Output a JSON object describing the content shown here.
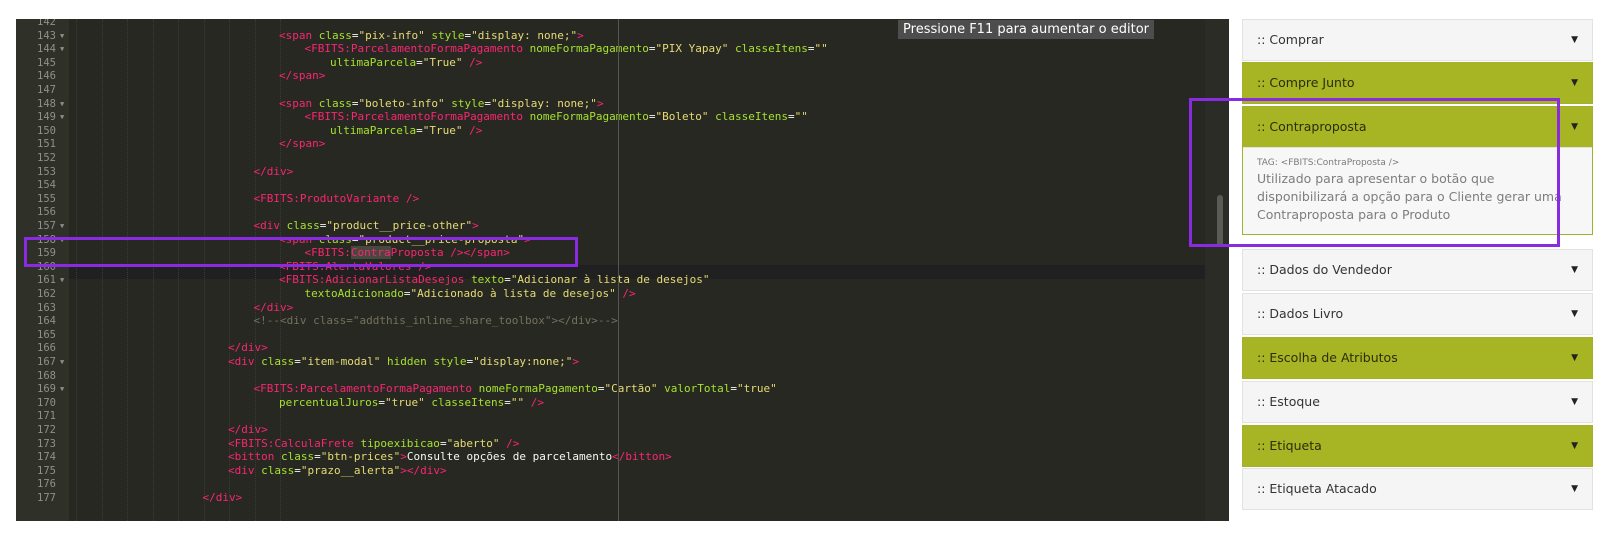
{
  "editor": {
    "hint": "Pressione F11 para aumentar o editor",
    "lines": [
      {
        "num": "142",
        "fold": false,
        "indent": 0,
        "tokens": []
      },
      {
        "num": "143",
        "fold": true,
        "indent": 8,
        "tokens": [
          {
            "t": "tag",
            "v": "<span "
          },
          {
            "t": "attr",
            "v": "class"
          },
          {
            "t": "txt",
            "v": "="
          },
          {
            "t": "str",
            "v": "\"pix-info\""
          },
          {
            "t": "attr",
            "v": " style"
          },
          {
            "t": "txt",
            "v": "="
          },
          {
            "t": "str",
            "v": "\"display: none;\""
          },
          {
            "t": "tag",
            "v": ">"
          }
        ]
      },
      {
        "num": "144",
        "fold": true,
        "indent": 9,
        "tokens": [
          {
            "t": "tag",
            "v": "<FBITS:ParcelamentoFormaPagamento "
          },
          {
            "t": "attr",
            "v": "nomeFormaPagamento"
          },
          {
            "t": "txt",
            "v": "="
          },
          {
            "t": "str",
            "v": "\"PIX Yapay\""
          },
          {
            "t": "attr",
            "v": " classeItens"
          },
          {
            "t": "txt",
            "v": "="
          },
          {
            "t": "str",
            "v": "\"\""
          }
        ]
      },
      {
        "num": "145",
        "fold": false,
        "indent": 10,
        "tokens": [
          {
            "t": "attr",
            "v": "ultimaParcela"
          },
          {
            "t": "txt",
            "v": "="
          },
          {
            "t": "str",
            "v": "\"True\""
          },
          {
            "t": "tag",
            "v": " />"
          }
        ]
      },
      {
        "num": "146",
        "fold": false,
        "indent": 8,
        "tokens": [
          {
            "t": "tag",
            "v": "</span>"
          }
        ]
      },
      {
        "num": "147",
        "fold": false,
        "indent": 0,
        "tokens": []
      },
      {
        "num": "148",
        "fold": true,
        "indent": 8,
        "tokens": [
          {
            "t": "tag",
            "v": "<span "
          },
          {
            "t": "attr",
            "v": "class"
          },
          {
            "t": "txt",
            "v": "="
          },
          {
            "t": "str",
            "v": "\"boleto-info\""
          },
          {
            "t": "attr",
            "v": " style"
          },
          {
            "t": "txt",
            "v": "="
          },
          {
            "t": "str",
            "v": "\"display: none;\""
          },
          {
            "t": "tag",
            "v": ">"
          }
        ]
      },
      {
        "num": "149",
        "fold": true,
        "indent": 9,
        "tokens": [
          {
            "t": "tag",
            "v": "<FBITS:ParcelamentoFormaPagamento "
          },
          {
            "t": "attr",
            "v": "nomeFormaPagamento"
          },
          {
            "t": "txt",
            "v": "="
          },
          {
            "t": "str",
            "v": "\"Boleto\""
          },
          {
            "t": "attr",
            "v": " classeItens"
          },
          {
            "t": "txt",
            "v": "="
          },
          {
            "t": "str",
            "v": "\"\""
          }
        ]
      },
      {
        "num": "150",
        "fold": false,
        "indent": 10,
        "tokens": [
          {
            "t": "attr",
            "v": "ultimaParcela"
          },
          {
            "t": "txt",
            "v": "="
          },
          {
            "t": "str",
            "v": "\"True\""
          },
          {
            "t": "tag",
            "v": " />"
          }
        ]
      },
      {
        "num": "151",
        "fold": false,
        "indent": 8,
        "tokens": [
          {
            "t": "tag",
            "v": "</span>"
          }
        ]
      },
      {
        "num": "152",
        "fold": false,
        "indent": 0,
        "tokens": []
      },
      {
        "num": "153",
        "fold": false,
        "indent": 7,
        "tokens": [
          {
            "t": "tag",
            "v": "</div>"
          }
        ]
      },
      {
        "num": "154",
        "fold": false,
        "indent": 0,
        "tokens": []
      },
      {
        "num": "155",
        "fold": false,
        "indent": 7,
        "tokens": [
          {
            "t": "tag",
            "v": "<FBITS:ProdutoVariante />"
          }
        ]
      },
      {
        "num": "156",
        "fold": false,
        "indent": 0,
        "tokens": []
      },
      {
        "num": "157",
        "fold": true,
        "indent": 7,
        "tokens": [
          {
            "t": "tag",
            "v": "<div "
          },
          {
            "t": "attr",
            "v": "class"
          },
          {
            "t": "txt",
            "v": "="
          },
          {
            "t": "str",
            "v": "\"product__price-other\""
          },
          {
            "t": "tag",
            "v": ">"
          }
        ]
      },
      {
        "num": "158",
        "fold": true,
        "indent": 8,
        "tokens": [
          {
            "t": "tag",
            "v": "<span "
          },
          {
            "t": "attr",
            "v": "class"
          },
          {
            "t": "txt",
            "v": "="
          },
          {
            "t": "str",
            "v": "\"product__price-proposta\""
          },
          {
            "t": "tag",
            "v": ">"
          }
        ]
      },
      {
        "num": "159",
        "fold": false,
        "indent": 9,
        "active": true,
        "tokens": [
          {
            "t": "tag",
            "v": "<FBITS:"
          },
          {
            "t": "tag hl",
            "v": "Contra"
          },
          {
            "t": "tag",
            "v": "Proposta />"
          },
          {
            "t": "tag",
            "v": "</span>"
          }
        ]
      },
      {
        "num": "160",
        "fold": false,
        "indent": 8,
        "tokens": [
          {
            "t": "tag",
            "v": "<FBITS:AlertaValores />"
          }
        ]
      },
      {
        "num": "161",
        "fold": true,
        "indent": 8,
        "tokens": [
          {
            "t": "tag",
            "v": "<FBITS:AdicionarListaDesejos "
          },
          {
            "t": "attr",
            "v": "texto"
          },
          {
            "t": "txt",
            "v": "="
          },
          {
            "t": "str",
            "v": "\"Adicionar à lista de desejos\""
          }
        ]
      },
      {
        "num": "162",
        "fold": false,
        "indent": 9,
        "tokens": [
          {
            "t": "attr",
            "v": "textoAdicionado"
          },
          {
            "t": "txt",
            "v": "="
          },
          {
            "t": "str",
            "v": "\"Adicionado à lista de desejos\""
          },
          {
            "t": "tag",
            "v": " />"
          }
        ]
      },
      {
        "num": "163",
        "fold": false,
        "indent": 7,
        "tokens": [
          {
            "t": "tag",
            "v": "</div>"
          }
        ]
      },
      {
        "num": "164",
        "fold": false,
        "indent": 7,
        "tokens": [
          {
            "t": "cmt",
            "v": "<!--<div class=\"addthis_inline_share_toolbox\"></div>-->"
          }
        ]
      },
      {
        "num": "165",
        "fold": false,
        "indent": 0,
        "tokens": []
      },
      {
        "num": "166",
        "fold": false,
        "indent": 6,
        "tokens": [
          {
            "t": "tag",
            "v": "</div>"
          }
        ]
      },
      {
        "num": "167",
        "fold": true,
        "indent": 6,
        "tokens": [
          {
            "t": "tag",
            "v": "<div "
          },
          {
            "t": "attr",
            "v": "class"
          },
          {
            "t": "txt",
            "v": "="
          },
          {
            "t": "str",
            "v": "\"item-modal\""
          },
          {
            "t": "attr",
            "v": " hidden style"
          },
          {
            "t": "txt",
            "v": "="
          },
          {
            "t": "str",
            "v": "\"display:none;\""
          },
          {
            "t": "tag",
            "v": ">"
          }
        ]
      },
      {
        "num": "168",
        "fold": false,
        "indent": 0,
        "tokens": []
      },
      {
        "num": "169",
        "fold": true,
        "indent": 7,
        "tokens": [
          {
            "t": "tag",
            "v": "<FBITS:ParcelamentoFormaPagamento "
          },
          {
            "t": "attr",
            "v": "nomeFormaPagamento"
          },
          {
            "t": "txt",
            "v": "="
          },
          {
            "t": "str",
            "v": "\"Cartão\""
          },
          {
            "t": "attr",
            "v": " valorTotal"
          },
          {
            "t": "txt",
            "v": "="
          },
          {
            "t": "str",
            "v": "\"true\""
          }
        ]
      },
      {
        "num": "170",
        "fold": false,
        "indent": 8,
        "tokens": [
          {
            "t": "attr",
            "v": "percentualJuros"
          },
          {
            "t": "txt",
            "v": "="
          },
          {
            "t": "str",
            "v": "\"true\""
          },
          {
            "t": "attr",
            "v": " classeItens"
          },
          {
            "t": "txt",
            "v": "="
          },
          {
            "t": "str",
            "v": "\"\""
          },
          {
            "t": "tag",
            "v": " />"
          }
        ]
      },
      {
        "num": "171",
        "fold": false,
        "indent": 0,
        "tokens": []
      },
      {
        "num": "172",
        "fold": false,
        "indent": 6,
        "tokens": [
          {
            "t": "tag",
            "v": "</div>"
          }
        ]
      },
      {
        "num": "173",
        "fold": false,
        "indent": 6,
        "tokens": [
          {
            "t": "tag",
            "v": "<FBITS:CalculaFrete "
          },
          {
            "t": "attr",
            "v": "tipoexibicao"
          },
          {
            "t": "txt",
            "v": "="
          },
          {
            "t": "str",
            "v": "\"aberto\""
          },
          {
            "t": "tag",
            "v": " />"
          }
        ]
      },
      {
        "num": "174",
        "fold": false,
        "indent": 6,
        "tokens": [
          {
            "t": "tag",
            "v": "<bitton "
          },
          {
            "t": "attr",
            "v": "class"
          },
          {
            "t": "txt",
            "v": "="
          },
          {
            "t": "str",
            "v": "\"btn-prices\""
          },
          {
            "t": "tag",
            "v": ">"
          },
          {
            "t": "txt",
            "v": "Consulte opções de parcelamento"
          },
          {
            "t": "tag",
            "v": "</bitton>"
          }
        ]
      },
      {
        "num": "175",
        "fold": false,
        "indent": 6,
        "tokens": [
          {
            "t": "tag",
            "v": "<div "
          },
          {
            "t": "attr",
            "v": "class"
          },
          {
            "t": "txt",
            "v": "="
          },
          {
            "t": "str",
            "v": "\"prazo__alerta\""
          },
          {
            "t": "tag",
            "v": "></div>"
          }
        ]
      },
      {
        "num": "176",
        "fold": false,
        "indent": 0,
        "tokens": []
      },
      {
        "num": "177",
        "fold": false,
        "indent": 5,
        "tokens": [
          {
            "t": "tag",
            "v": "</div>"
          }
        ]
      }
    ]
  },
  "sidebar": {
    "panels": [
      {
        "label": ":: Comprar",
        "style": "grey",
        "expanded": false
      },
      {
        "label": ":: Compre Junto",
        "style": "green",
        "expanded": false
      },
      {
        "label": ":: Contraproposta",
        "style": "green",
        "expanded": true,
        "tag": "TAG: <FBITS:ContraProposta />",
        "description": "Utilizado para apresentar o botão que disponibilizará a opção para o Cliente gerar uma Contraproposta para o Produto"
      },
      {
        "label": ":: Dados do Vendedor",
        "style": "grey",
        "expanded": false
      },
      {
        "label": ":: Dados Livro",
        "style": "grey",
        "expanded": false
      },
      {
        "label": ":: Escolha de Atributos",
        "style": "green",
        "expanded": false
      },
      {
        "label": ":: Estoque",
        "style": "grey",
        "expanded": false
      },
      {
        "label": ":: Etiqueta",
        "style": "green",
        "expanded": false
      },
      {
        "label": ":: Etiqueta Atacado",
        "style": "grey",
        "expanded": false
      }
    ]
  },
  "colors": {
    "annotation": "#8a2be2",
    "panel_green": "#a7b424",
    "editor_bg": "#272822"
  }
}
